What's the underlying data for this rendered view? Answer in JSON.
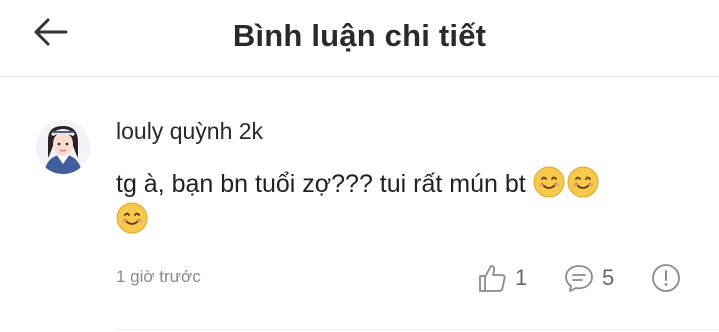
{
  "header": {
    "title": "Bình luận chi tiết",
    "back_icon": "arrow-left-icon"
  },
  "comment": {
    "author": "louly quỳnh 2k",
    "text": "tg à, bạn bn tuổi zợ??? tui rất mún bt",
    "emojis": [
      "smiling-face-emoji",
      "smiling-face-emoji",
      "smiling-face-emoji"
    ],
    "time": "1 giờ trước",
    "likes": "1",
    "replies": "5",
    "icons": {
      "like": "thumbs-up-icon",
      "reply": "chat-bubble-icon",
      "report": "exclamation-circle-icon"
    },
    "colors": {
      "icon": "#8a8a8a",
      "emoji": "#f7c948"
    }
  }
}
